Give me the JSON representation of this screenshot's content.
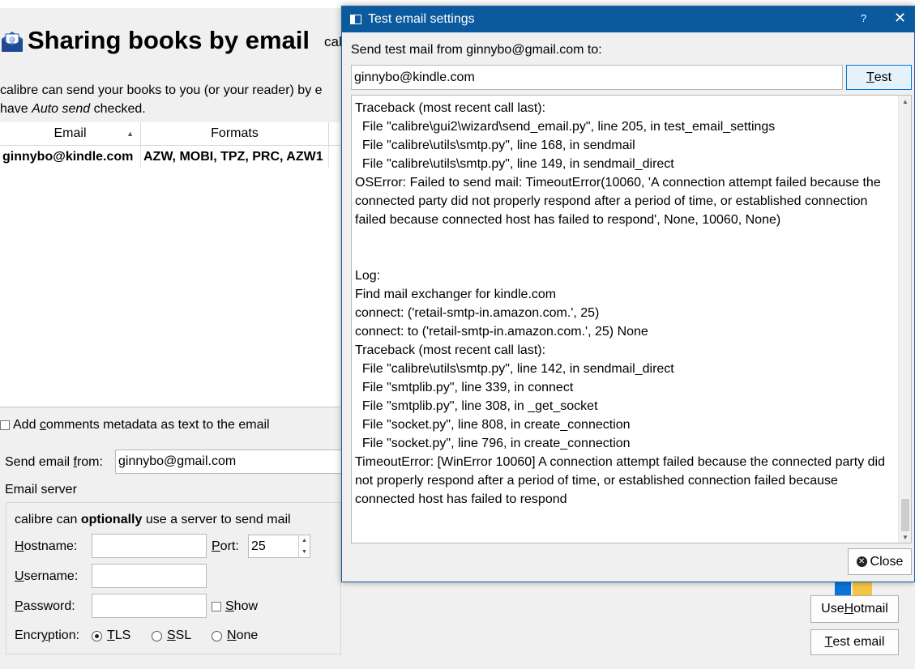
{
  "page": {
    "title": "Sharing books by email",
    "title_suffix": "cal",
    "intro_line1": "calibre can send your books to you (or your reader) by e",
    "intro_line2_pre": "have ",
    "intro_line2_em": "Auto send",
    "intro_line2_post": " checked."
  },
  "table": {
    "columns": [
      "Email",
      "Formats"
    ],
    "rows": [
      {
        "email": "ginnybo@kindle.com",
        "formats": "AZW, MOBI, TPZ, PRC, AZW1"
      }
    ]
  },
  "options": {
    "add_comments_label_pre": "Add ",
    "add_comments_label_u": "c",
    "add_comments_label_post": "omments metadata as text to the email",
    "add_comments_checked": false
  },
  "send_from": {
    "label_pre": "Send email ",
    "label_u": "f",
    "label_post": "rom:",
    "value": "ginnybo@gmail.com"
  },
  "server": {
    "group_label": "Email server",
    "intro_pre": "calibre can ",
    "intro_bold": "optionally",
    "intro_post": " use a server to send mail",
    "hostname_u": "H",
    "hostname_rest": "ostname:",
    "hostname_value": "",
    "port_u": "P",
    "port_rest": "ort:",
    "port_value": "25",
    "username_u": "U",
    "username_rest": "sername:",
    "username_value": "",
    "password_u": "P",
    "password_rest": "assword:",
    "password_value": "",
    "show_u": "S",
    "show_rest": "how",
    "encryption_pre": "Encr",
    "encryption_u": "y",
    "encryption_post": "ption:",
    "tls_u": "T",
    "tls_rest": "LS",
    "ssl_u": "S",
    "ssl_rest": "SL",
    "none_u": "N",
    "none_rest": "one",
    "selected_encryption": "TLS"
  },
  "side_buttons": {
    "hotmail_pre": "Use ",
    "hotmail_u": "H",
    "hotmail_post": "otmail",
    "test_email_u": "T",
    "test_email_rest": "est email"
  },
  "dialog": {
    "title": "Test email settings",
    "help": "?",
    "close_x": "✕",
    "send_label": "Send test mail from ginnybo@gmail.com to:",
    "to_value": "ginnybo@kindle.com",
    "test_u": "T",
    "test_rest": "est",
    "log": "Traceback (most recent call last):\n  File \"calibre\\gui2\\wizard\\send_email.py\", line 205, in test_email_settings\n  File \"calibre\\utils\\smtp.py\", line 168, in sendmail\n  File \"calibre\\utils\\smtp.py\", line 149, in sendmail_direct\nOSError: Failed to send mail: TimeoutError(10060, 'A connection attempt failed because the connected party did not properly respond after a period of time, or established connection failed because connected host has failed to respond', None, 10060, None)\n\n\nLog:\nFind mail exchanger for kindle.com\nconnect: ('retail-smtp-in.amazon.com.', 25)\nconnect: to ('retail-smtp-in.amazon.com.', 25) None\nTraceback (most recent call last):\n  File \"calibre\\utils\\smtp.py\", line 142, in sendmail_direct\n  File \"smtplib.py\", line 339, in connect\n  File \"smtplib.py\", line 308, in _get_socket\n  File \"socket.py\", line 808, in create_connection\n  File \"socket.py\", line 796, in create_connection\nTimeoutError: [WinError 10060] A connection attempt failed because the connected party did not properly respond after a period of time, or established connection failed because connected host has failed to respond",
    "close_label": "Close"
  },
  "colors": {
    "titlebar": "#0b5a9e",
    "background": "#f0f0f0",
    "focus_border": "#0078d7"
  },
  "icons": {
    "title": "envelope-icon",
    "dialog": "window-icon",
    "close_button": "close-circle-icon",
    "hotmail": "windows-logo-icon"
  }
}
